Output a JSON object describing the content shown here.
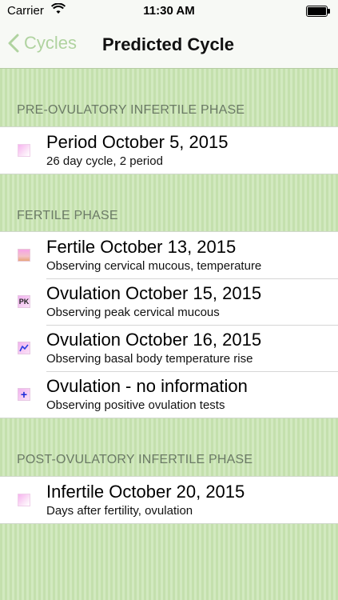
{
  "status_bar": {
    "carrier": "Carrier",
    "time": "11:30 AM"
  },
  "nav": {
    "back_label": "Cycles",
    "title": "Predicted Cycle"
  },
  "colors": {
    "accent_green": "#b0d3a0",
    "background_green": "#c9e3b5"
  },
  "sections": [
    {
      "header": "PRE-OVULATORY INFERTILE PHASE",
      "rows": [
        {
          "icon": "period-icon",
          "title": "Period October 5, 2015",
          "subtitle": "26 day cycle, 2 period"
        }
      ]
    },
    {
      "header": "FERTILE PHASE",
      "rows": [
        {
          "icon": "fertile-icon",
          "title": "Fertile October 13, 2015",
          "subtitle": "Observing cervical mucous, temperature"
        },
        {
          "icon": "peak-icon",
          "icon_text": "PK",
          "title": "Ovulation October 15, 2015",
          "subtitle": "Observing peak cervical mucous"
        },
        {
          "icon": "temperature-rise-icon",
          "title": "Ovulation October 16, 2015",
          "subtitle": "Observing basal body temperature rise"
        },
        {
          "icon": "positive-test-icon",
          "icon_text": "+",
          "title": "Ovulation - no information",
          "subtitle": "Observing positive ovulation tests"
        }
      ]
    },
    {
      "header": "POST-OVULATORY INFERTILE PHASE",
      "rows": [
        {
          "icon": "infertile-icon",
          "title": "Infertile October 20, 2015",
          "subtitle": "Days after fertility, ovulation"
        }
      ]
    }
  ]
}
